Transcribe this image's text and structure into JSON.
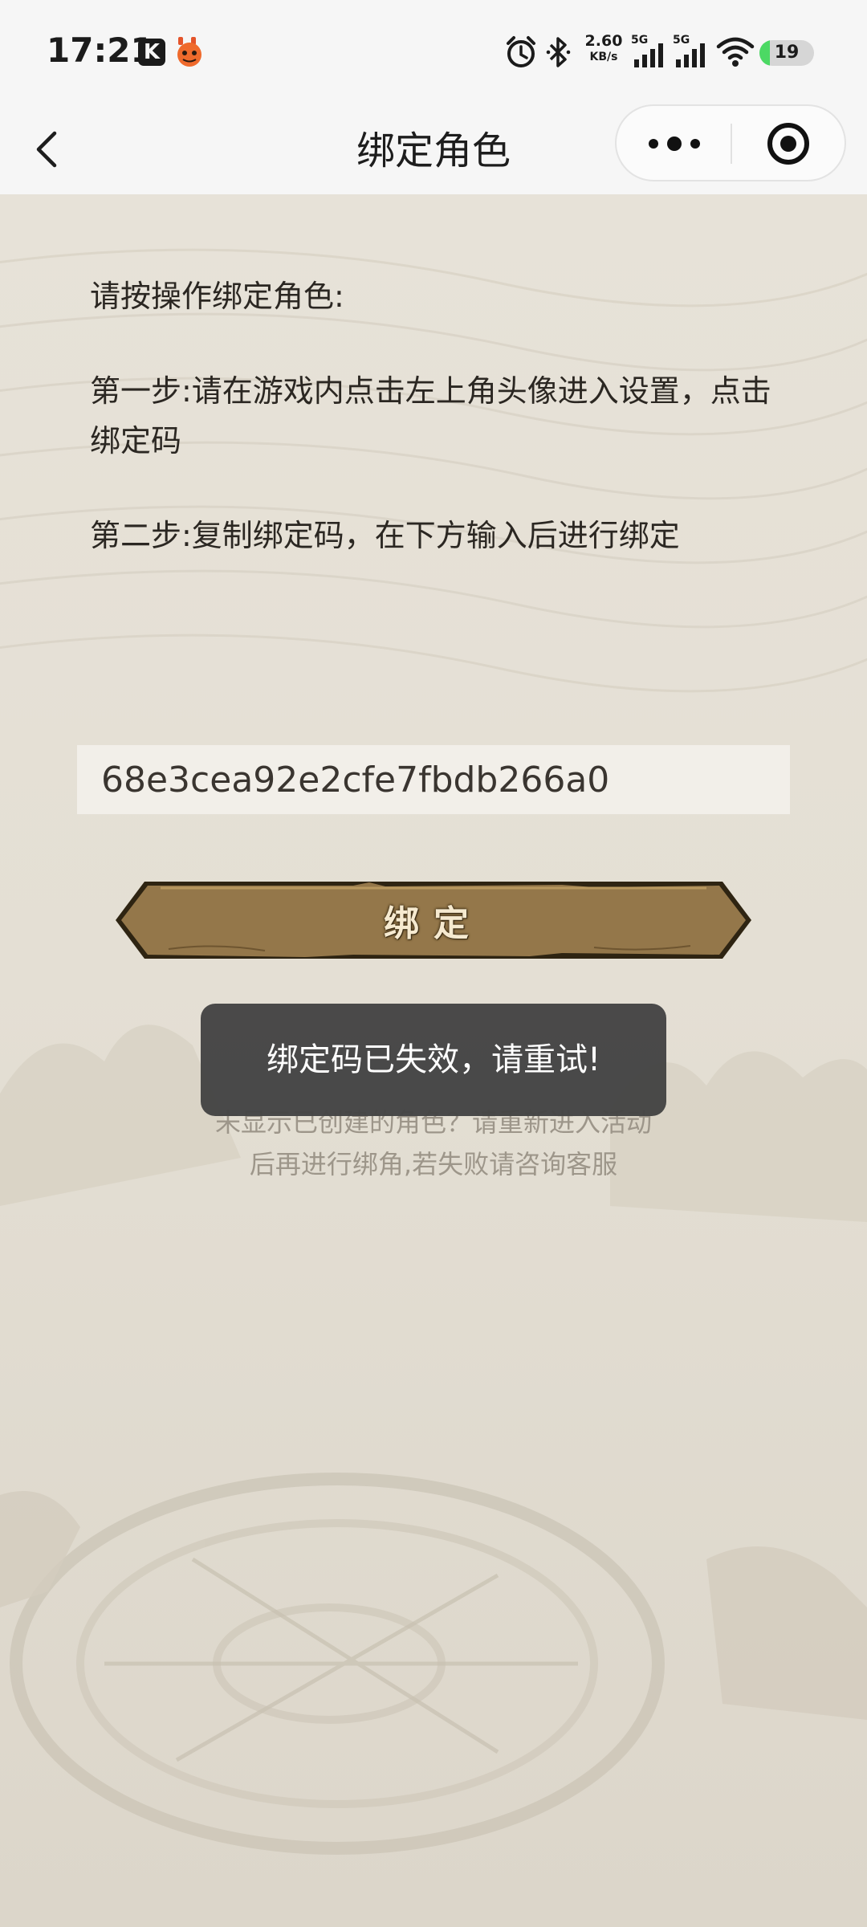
{
  "status_bar": {
    "time": "17:21",
    "k_icon_letter": "K",
    "net_speed_value": "2.60",
    "net_speed_unit": "KB/s",
    "signal1_label": "5G",
    "signal2_label": "5G",
    "battery_level": "19",
    "battery_fraction": 0.19,
    "icons": [
      "k-app-icon",
      "game-app-icon",
      "alarm-icon",
      "bluetooth-icon",
      "signal-icon",
      "signal-icon",
      "wifi-icon",
      "battery-icon"
    ]
  },
  "nav": {
    "title": "绑定角色",
    "icons": [
      "back-arrow-icon",
      "more-dots-icon",
      "close-circle-icon"
    ]
  },
  "instructions": {
    "intro": "请按操作绑定角色:",
    "step1": "第一步:请在游戏内点击左上角头像进入设置，点击绑定码",
    "step2": "第二步:复制绑定码，在下方输入后进行绑定"
  },
  "bind_form": {
    "code_value": "68e3cea92e2cfe7fbdb266a0",
    "button_label": "绑定"
  },
  "tip": {
    "line1": "未显示已创建的角色？请重新进入活动",
    "line2": "后再进行绑角,若失败请咨询客服"
  },
  "toast": {
    "message": "绑定码已失效，请重试!"
  },
  "colors": {
    "page_background": "#e6e1d6",
    "status_bar_background": "#f6f6f6",
    "button_fill": "#94774a",
    "button_border": "#2e2412",
    "toast_background": "#444444",
    "battery_green": "#4cd964",
    "tip_text": "#9d968a"
  }
}
